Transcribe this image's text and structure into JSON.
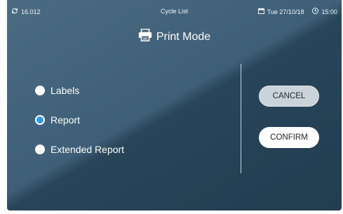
{
  "status_bar": {
    "version": "16.012",
    "screen_title": "Cycle List",
    "date": "Tue 27/10/18",
    "time": "15:00"
  },
  "header": {
    "title": "Print Mode"
  },
  "print_options": [
    {
      "label": "Labels",
      "selected": false
    },
    {
      "label": "Report",
      "selected": true
    },
    {
      "label": "Extended Report",
      "selected": false
    }
  ],
  "actions": {
    "cancel_label": "CANCEL",
    "confirm_label": "CONFIRM"
  },
  "colors": {
    "accent": "#2f9be6",
    "background_dark": "#223c50",
    "background_light": "#4a6b82"
  },
  "icons": {
    "version": "sync-icon",
    "date": "calendar-icon",
    "time": "clock-icon",
    "title": "printer-icon"
  }
}
